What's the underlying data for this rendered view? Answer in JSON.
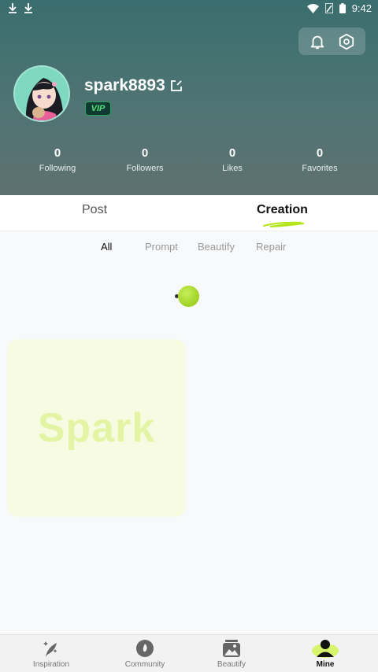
{
  "status_bar": {
    "time": "9:42",
    "left_icons": [
      "download-icon",
      "download-icon"
    ],
    "right_icons": [
      "wifi-icon",
      "signal-icon",
      "battery-icon"
    ]
  },
  "header_actions": [
    "bell-icon",
    "settings-icon"
  ],
  "profile": {
    "username": "spark8893",
    "badge": "VIP",
    "edit_icon": "edit-icon"
  },
  "stats": [
    {
      "count": "0",
      "label": "Following"
    },
    {
      "count": "0",
      "label": "Followers"
    },
    {
      "count": "0",
      "label": "Likes"
    },
    {
      "count": "0",
      "label": "Favorites"
    }
  ],
  "tabs": [
    {
      "label": "Post",
      "active": false
    },
    {
      "label": "Creation",
      "active": true
    }
  ],
  "subtabs": [
    {
      "label": "All",
      "active": true
    },
    {
      "label": "Prompt",
      "active": false
    },
    {
      "label": "Beautify",
      "active": false
    },
    {
      "label": "Repair",
      "active": false
    }
  ],
  "card": {
    "watermark": "Spark"
  },
  "bottom_nav": [
    {
      "label": "Inspiration",
      "icon": "feather-sparkle-icon",
      "active": false
    },
    {
      "label": "Community",
      "icon": "community-icon",
      "active": false
    },
    {
      "label": "Beautify",
      "icon": "gallery-icon",
      "active": false
    },
    {
      "label": "Mine",
      "icon": "person-icon",
      "active": true
    }
  ],
  "colors": {
    "accent": "#b5e61d",
    "header_top": "#3a6e6e",
    "header_bottom": "#5f7072"
  }
}
